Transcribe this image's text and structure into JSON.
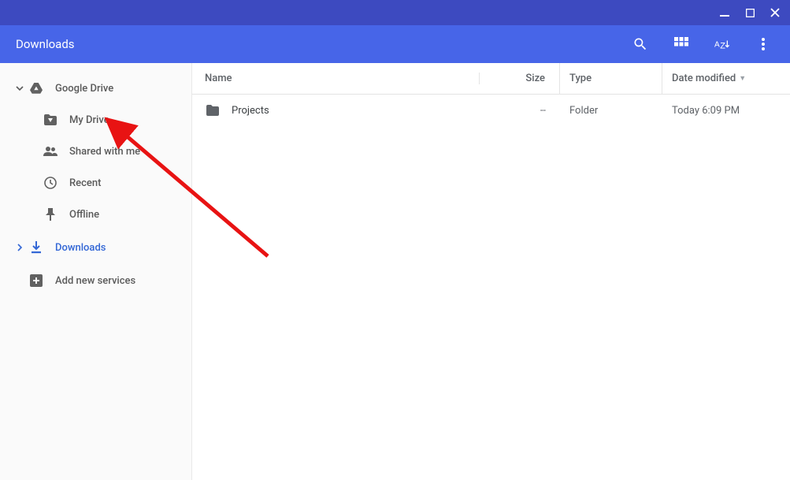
{
  "window": {
    "title": "Downloads"
  },
  "sidebar": {
    "google_drive": {
      "label": "Google Drive"
    },
    "my_drive": {
      "label": "My Drive"
    },
    "shared": {
      "label": "Shared with me"
    },
    "recent": {
      "label": "Recent"
    },
    "offline": {
      "label": "Offline"
    },
    "downloads": {
      "label": "Downloads"
    },
    "add_services": {
      "label": "Add new services"
    }
  },
  "columns": {
    "name": "Name",
    "size": "Size",
    "type": "Type",
    "date": "Date modified"
  },
  "rows": [
    {
      "name": "Projects",
      "size": "--",
      "type": "Folder",
      "date": "Today 6:09 PM"
    }
  ],
  "header_icons": {
    "search": "search-icon",
    "grid": "grid-view-icon",
    "sort_az": "AZ",
    "more": "more-vert-icon"
  }
}
